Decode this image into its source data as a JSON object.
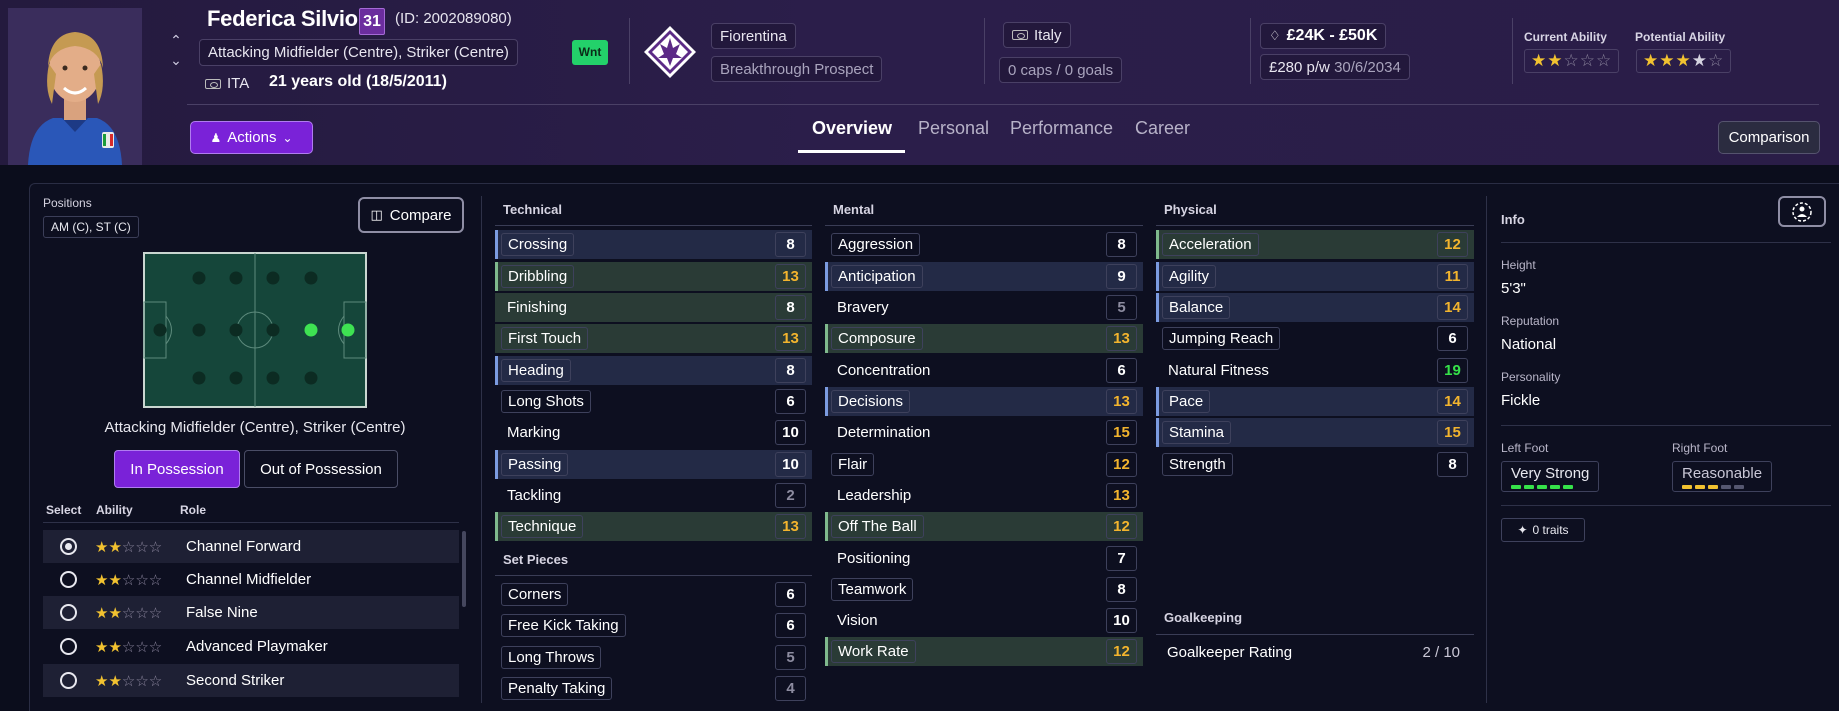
{
  "header": {
    "name": "Federica Silvioni",
    "number": "31",
    "id_text": "(ID: 2002089080)",
    "positions": "Attacking Midfielder (Centre), Striker (Centre)",
    "nationality_code": "ITA",
    "age": "21 years old (18/5/2011)",
    "tag": "Wnt",
    "club": "Fiorentina",
    "status": "Breakthrough Prospect",
    "nation": "Italy",
    "caps": "0 caps / 0 goals",
    "value": "£24K - £50K",
    "wage": "£280 p/w",
    "contract_end": "30/6/2034",
    "current_ability_label": "Current Ability",
    "potential_ability_label": "Potential Ability",
    "current_ability_stars": 2,
    "potential_ability_stars": 3.5,
    "actions_label": "Actions",
    "comparison_label": "Comparison",
    "tabs": [
      "Overview",
      "Personal",
      "Performance",
      "Career"
    ],
    "active_tab": "Overview"
  },
  "left_panel": {
    "positions_label": "Positions",
    "positions_value": "AM (C), ST (C)",
    "compare_label": "Compare",
    "position_text": "Attacking Midfielder (Centre), Striker (Centre)",
    "in_possession": "In Possession",
    "out_of_possession": "Out of Possession",
    "col_select": "Select",
    "col_ability": "Ability",
    "col_role": "Role",
    "roles": [
      {
        "name": "Channel Forward",
        "stars": 2,
        "selected": true
      },
      {
        "name": "Channel Midfielder",
        "stars": 2,
        "selected": false
      },
      {
        "name": "False Nine",
        "stars": 2,
        "selected": false
      },
      {
        "name": "Advanced Playmaker",
        "stars": 2,
        "selected": false
      },
      {
        "name": "Second Striker",
        "stars": 2,
        "selected": false
      }
    ]
  },
  "technical": {
    "title": "Technical",
    "items": [
      {
        "name": "Crossing",
        "value": "8"
      },
      {
        "name": "Dribbling",
        "value": "13"
      },
      {
        "name": "Finishing",
        "value": "8"
      },
      {
        "name": "First Touch",
        "value": "13"
      },
      {
        "name": "Heading",
        "value": "8"
      },
      {
        "name": "Long Shots",
        "value": "6"
      },
      {
        "name": "Marking",
        "value": "10"
      },
      {
        "name": "Passing",
        "value": "10"
      },
      {
        "name": "Tackling",
        "value": "2"
      },
      {
        "name": "Technique",
        "value": "13"
      }
    ]
  },
  "set_pieces": {
    "title": "Set Pieces",
    "items": [
      {
        "name": "Corners",
        "value": "6"
      },
      {
        "name": "Free Kick Taking",
        "value": "6"
      },
      {
        "name": "Long Throws",
        "value": "5"
      },
      {
        "name": "Penalty Taking",
        "value": "4"
      }
    ]
  },
  "mental": {
    "title": "Mental",
    "items": [
      {
        "name": "Aggression",
        "value": "8"
      },
      {
        "name": "Anticipation",
        "value": "9"
      },
      {
        "name": "Bravery",
        "value": "5"
      },
      {
        "name": "Composure",
        "value": "13"
      },
      {
        "name": "Concentration",
        "value": "6"
      },
      {
        "name": "Decisions",
        "value": "13"
      },
      {
        "name": "Determination",
        "value": "15"
      },
      {
        "name": "Flair",
        "value": "12"
      },
      {
        "name": "Leadership",
        "value": "13"
      },
      {
        "name": "Off The Ball",
        "value": "12"
      },
      {
        "name": "Positioning",
        "value": "7"
      },
      {
        "name": "Teamwork",
        "value": "8"
      },
      {
        "name": "Vision",
        "value": "10"
      },
      {
        "name": "Work Rate",
        "value": "12"
      }
    ]
  },
  "physical": {
    "title": "Physical",
    "items": [
      {
        "name": "Acceleration",
        "value": "12"
      },
      {
        "name": "Agility",
        "value": "11"
      },
      {
        "name": "Balance",
        "value": "14"
      },
      {
        "name": "Jumping Reach",
        "value": "6"
      },
      {
        "name": "Natural Fitness",
        "value": "19"
      },
      {
        "name": "Pace",
        "value": "14"
      },
      {
        "name": "Stamina",
        "value": "15"
      },
      {
        "name": "Strength",
        "value": "8"
      }
    ]
  },
  "goalkeeping": {
    "title": "Goalkeeping",
    "rating_label": "Goalkeeper Rating",
    "rating_value": "2 / 10"
  },
  "info": {
    "title": "Info",
    "height_label": "Height",
    "height_value": "5'3\"",
    "reputation_label": "Reputation",
    "reputation_value": "National",
    "personality_label": "Personality",
    "personality_value": "Fickle",
    "left_foot_label": "Left Foot",
    "left_foot_value": "Very Strong",
    "left_foot_level": 5,
    "right_foot_label": "Right Foot",
    "right_foot_value": "Reasonable",
    "right_foot_level": 3,
    "traits": "0 traits"
  },
  "colors": {
    "accent": "#7a22d8",
    "highlight_yellow": "#f2b42e",
    "highlight_green": "#36e24a",
    "tag_green": "#23d16a"
  }
}
